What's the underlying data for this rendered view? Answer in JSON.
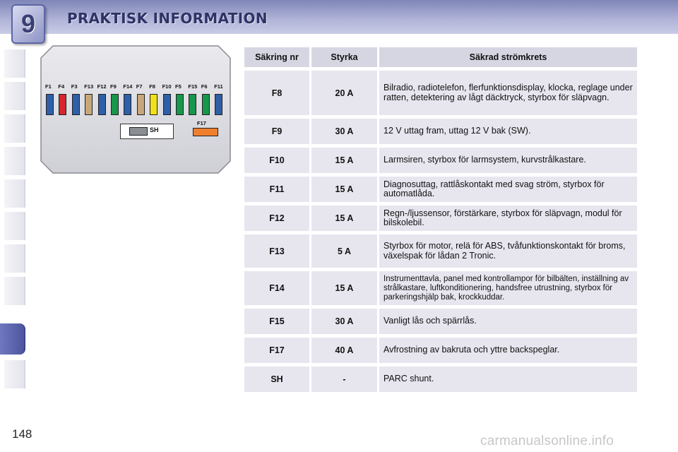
{
  "header": {
    "chapter": "9",
    "title": "PRAKTISK INFORMATION"
  },
  "page_number": "148",
  "watermark": "carmanualsonline.info",
  "diagram": {
    "fuse_labels": [
      "F1",
      "F4",
      "F3",
      "F13",
      "F12",
      "F9",
      "F14",
      "F7",
      "F8",
      "F10",
      "F5",
      "F15",
      "F6",
      "F11"
    ],
    "fuse_colors": [
      "#2e5fa8",
      "#d7262e",
      "#2e5fa8",
      "#c8a77a",
      "#2e5fa8",
      "#16974b",
      "#2e5fa8",
      "#c8a77a",
      "#f1e11a",
      "#2e5fa8",
      "#16974b",
      "#16974b",
      "#16974b",
      "#2e5fa8"
    ],
    "sh_label": "SH",
    "f17_label": "F17",
    "f17_color": "#f07f2d"
  },
  "table": {
    "headers": [
      "Säkring nr",
      "Styrka",
      "Säkrad strömkrets"
    ],
    "rows": [
      {
        "nr": "F8",
        "amp": "20 A",
        "desc": "Bilradio, radiotelefon, flerfunktionsdisplay, klocka, reglage under ratten, detektering av lågt däcktryck, styrbox för släpvagn."
      },
      {
        "nr": "F9",
        "amp": "30 A",
        "desc": "12 V uttag fram, uttag 12 V bak (SW)."
      },
      {
        "nr": "F10",
        "amp": "15 A",
        "desc": "Larmsiren, styrbox för larmsystem, kurvstrålkastare."
      },
      {
        "nr": "F11",
        "amp": "15 A",
        "desc": "Diagnosuttag, rattlåskontakt med svag ström, styrbox för automatlåda."
      },
      {
        "nr": "F12",
        "amp": "15 A",
        "desc": "Regn-/ljussensor, förstärkare, styrbox för släpvagn, modul för bilskolebil."
      },
      {
        "nr": "F13",
        "amp": "5 A",
        "desc": "Styrbox för motor, relä för ABS, tvåfunktionskontakt för broms, växelspak för lådan 2 Tronic."
      },
      {
        "nr": "F14",
        "amp": "15 A",
        "desc": "Instrumenttavla, panel med kontrollampor för bilbälten, inställning av strålkastare, luftkonditionering, handsfree utrustning, styrbox för parkeringshjälp bak, krockkuddar."
      },
      {
        "nr": "F15",
        "amp": "30 A",
        "desc": "Vanligt lås och spärrlås."
      },
      {
        "nr": "F17",
        "amp": "40 A",
        "desc": "Avfrostning av bakruta och yttre backspeglar."
      },
      {
        "nr": "SH",
        "amp": "-",
        "desc": "PARC shunt."
      }
    ]
  }
}
